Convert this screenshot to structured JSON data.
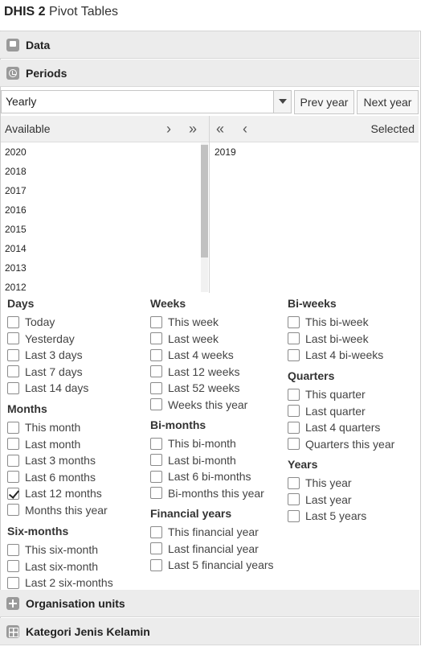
{
  "app": {
    "title_bold": "DHIS 2",
    "title_rest": "Pivot Tables"
  },
  "accordion": {
    "data": "Data",
    "periods": "Periods",
    "org_units": "Organisation units",
    "kategori": "Kategori Jenis Kelamin"
  },
  "period_type": {
    "value": "Yearly",
    "prev_label": "Prev year",
    "next_label": "Next year"
  },
  "selector": {
    "available_label": "Available",
    "selected_label": "Selected",
    "available": [
      "2020",
      "2018",
      "2017",
      "2016",
      "2015",
      "2014",
      "2013",
      "2012"
    ],
    "selected": [
      "2019"
    ]
  },
  "groups": {
    "days": {
      "title": "Days",
      "options": [
        "Today",
        "Yesterday",
        "Last 3 days",
        "Last 7 days",
        "Last 14 days"
      ]
    },
    "months": {
      "title": "Months",
      "options": [
        "This month",
        "Last month",
        "Last 3 months",
        "Last 6 months",
        "Last 12 months",
        "Months this year"
      ]
    },
    "six_months": {
      "title": "Six-months",
      "options": [
        "This six-month",
        "Last six-month",
        "Last 2 six-months"
      ]
    },
    "weeks": {
      "title": "Weeks",
      "options": [
        "This week",
        "Last week",
        "Last 4 weeks",
        "Last 12 weeks",
        "Last 52 weeks",
        "Weeks this year"
      ]
    },
    "bi_months": {
      "title": "Bi-months",
      "options": [
        "This bi-month",
        "Last bi-month",
        "Last 6 bi-months",
        "Bi-months this year"
      ]
    },
    "financial_years": {
      "title": "Financial years",
      "options": [
        "This financial year",
        "Last financial year",
        "Last 5 financial years"
      ]
    },
    "bi_weeks": {
      "title": "Bi-weeks",
      "options": [
        "This bi-week",
        "Last bi-week",
        "Last 4 bi-weeks"
      ]
    },
    "quarters": {
      "title": "Quarters",
      "options": [
        "This quarter",
        "Last quarter",
        "Last 4 quarters",
        "Quarters this year"
      ]
    },
    "years": {
      "title": "Years",
      "options": [
        "This year",
        "Last year",
        "Last 5 years"
      ]
    }
  },
  "checked": {
    "months": [
      "Last 12 months"
    ]
  },
  "icons": {
    "data": "database-icon",
    "periods": "clock-icon",
    "org_units": "plus-icon",
    "kategori": "grid-icon",
    "dropdown": "chevron-down-icon",
    "select_one": "chevron-right-icon",
    "select_all": "double-chevron-right-icon",
    "deselect_all": "double-chevron-left-icon",
    "deselect_one": "chevron-left-icon"
  }
}
